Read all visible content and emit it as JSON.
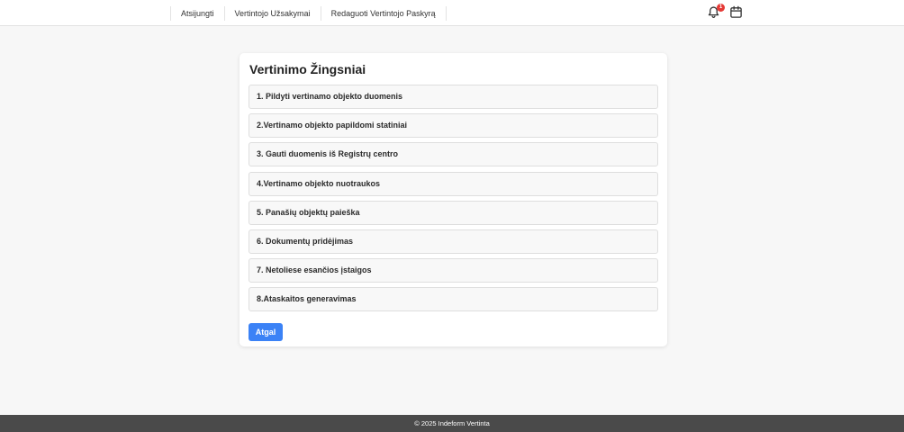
{
  "nav": {
    "items": [
      {
        "label": "Atsijungti"
      },
      {
        "label": "Vertintojo Užsakymai"
      },
      {
        "label": "Redaguoti Vertintojo Paskyrą"
      }
    ]
  },
  "header_icons": {
    "notifications": {
      "icon": "bell-icon",
      "count": "1"
    },
    "calendar": {
      "icon": "calendar-icon"
    }
  },
  "card": {
    "title": "Vertinimo Žingsniai",
    "steps": [
      {
        "label": "1. Pildyti vertinamo objekto duomenis"
      },
      {
        "label": "2.Vertinamo objekto papildomi statiniai"
      },
      {
        "label": "3. Gauti duomenis iš Registrų centro"
      },
      {
        "label": "4.Vertinamo objekto nuotraukos"
      },
      {
        "label": "5. Panašių objektų paieška"
      },
      {
        "label": "6. Dokumentų pridėjimas"
      },
      {
        "label": "7. Netoliese esančios įstaigos"
      },
      {
        "label": "8.Ataskaitos generavimas"
      }
    ],
    "back_label": "Atgal"
  },
  "footer": {
    "text": "© 2025 Indeform Vertinta"
  },
  "colors": {
    "accent": "#3b82f6",
    "badge": "#e53935",
    "footer_bg": "#4a4a4a"
  }
}
